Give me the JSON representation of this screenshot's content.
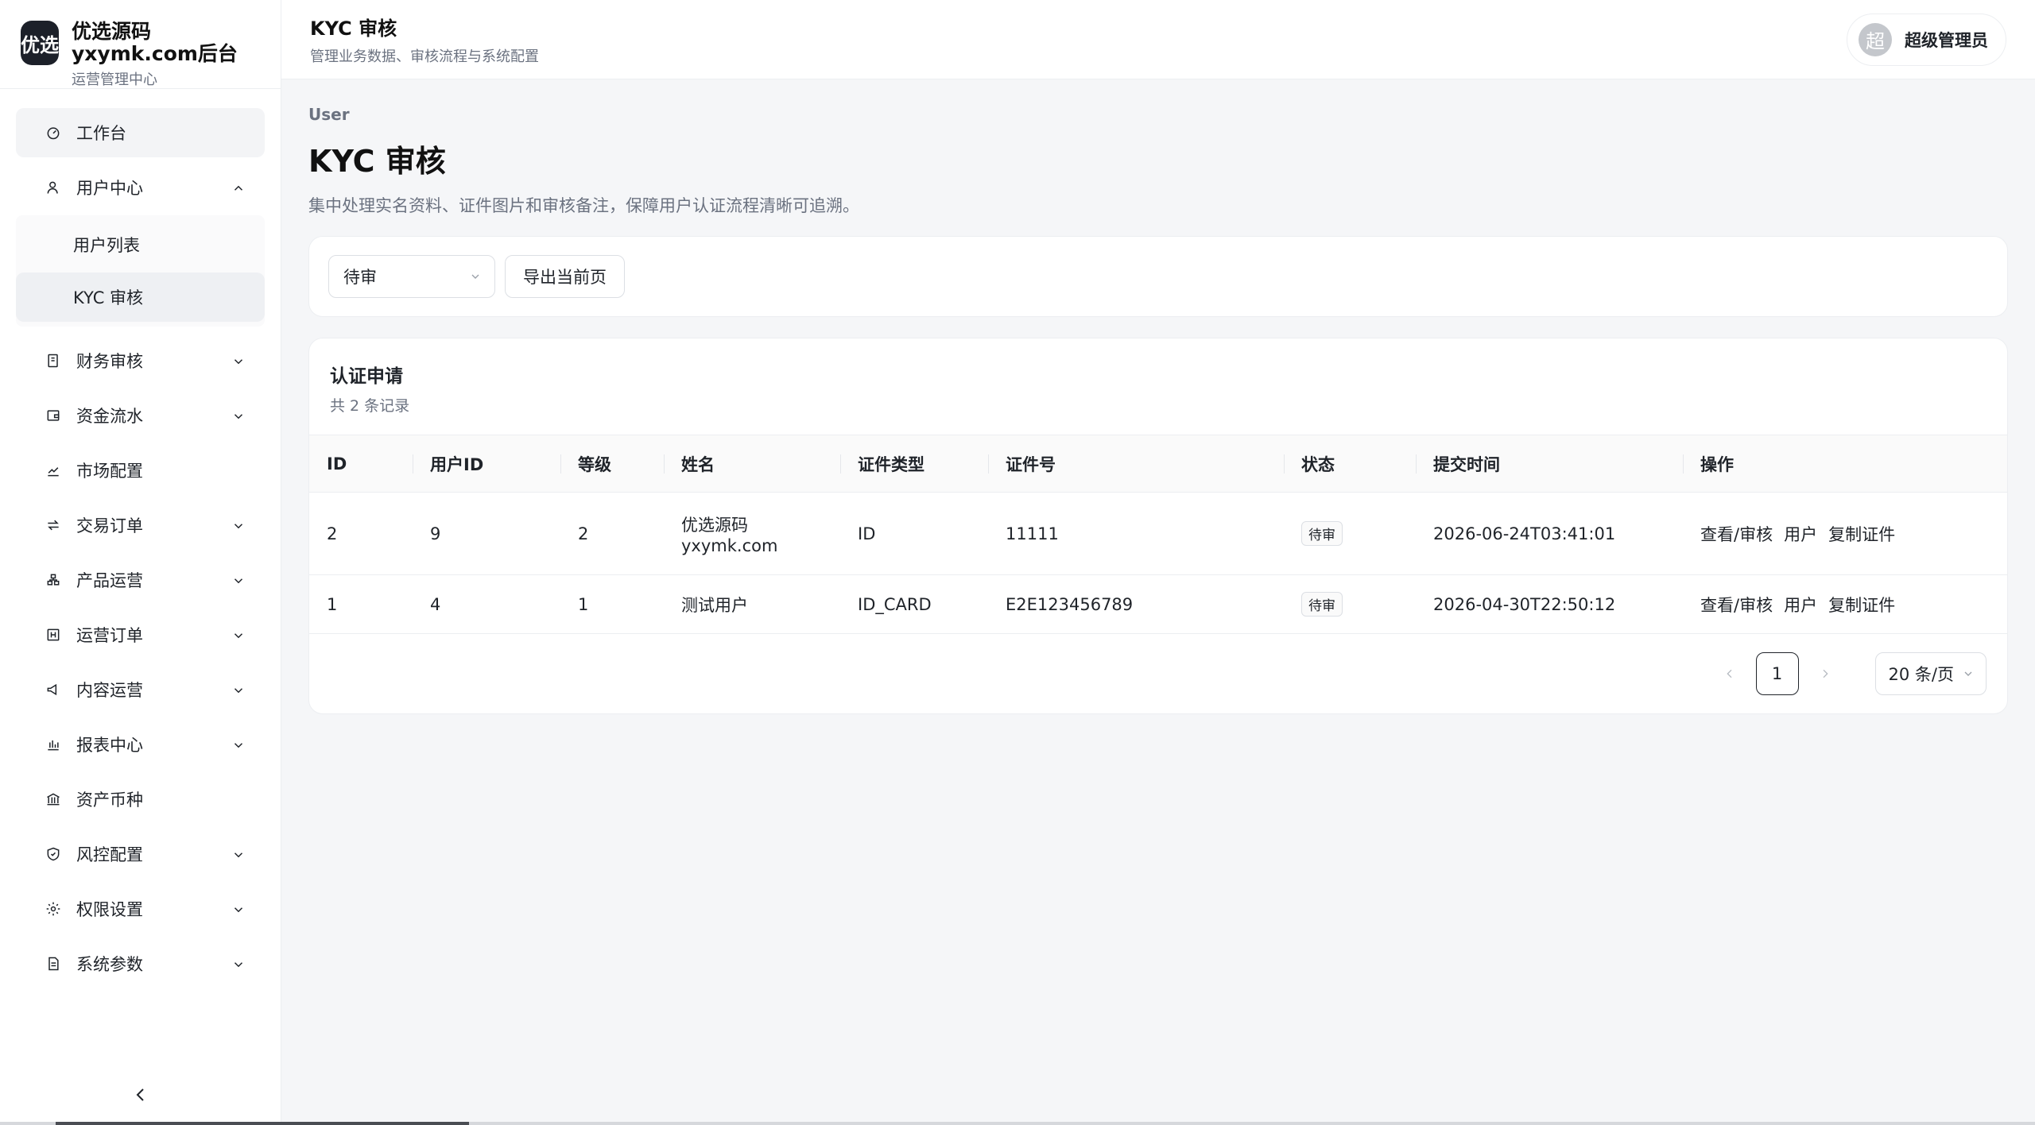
{
  "brand": {
    "logo": "优选",
    "title": "优选源码yxymk.com后台",
    "subtitle": "运营管理中心"
  },
  "nav": {
    "items": [
      {
        "label": "工作台",
        "icon": "dashboard-icon"
      },
      {
        "label": "用户中心",
        "icon": "user-icon",
        "expanded": true
      },
      {
        "label": "财务审核",
        "icon": "finance-icon"
      },
      {
        "label": "资金流水",
        "icon": "wallet-icon"
      },
      {
        "label": "市场配置",
        "icon": "trend-icon"
      },
      {
        "label": "交易订单",
        "icon": "exchange-icon"
      },
      {
        "label": "产品运营",
        "icon": "product-icon"
      },
      {
        "label": "运营订单",
        "icon": "order-icon"
      },
      {
        "label": "内容运营",
        "icon": "megaphone-icon"
      },
      {
        "label": "报表中心",
        "icon": "bar-chart-icon"
      },
      {
        "label": "资产币种",
        "icon": "bank-icon"
      },
      {
        "label": "风控配置",
        "icon": "shield-icon"
      },
      {
        "label": "权限设置",
        "icon": "gear-icon"
      },
      {
        "label": "系统参数",
        "icon": "document-icon"
      }
    ],
    "sub_items": [
      {
        "label": "用户列表"
      },
      {
        "label": "KYC 审核",
        "active": true
      }
    ]
  },
  "topbar": {
    "title": "KYC 审核",
    "subtitle": "管理业务数据、审核流程与系统配置",
    "avatar_char": "超",
    "user_name": "超级管理员"
  },
  "page": {
    "breadcrumb": "User",
    "title": "KYC 审核",
    "description": "集中处理实名资料、证件图片和审核备注，保障用户认证流程清晰可追溯。"
  },
  "filter": {
    "status_value": "待审",
    "export_label": "导出当前页"
  },
  "table": {
    "title": "认证申请",
    "count_text": "共 2 条记录",
    "columns": [
      "ID",
      "用户ID",
      "等级",
      "姓名",
      "证件类型",
      "证件号",
      "状态",
      "提交时间",
      "操作"
    ],
    "rows": [
      {
        "id": "2",
        "user_id": "9",
        "level": "2",
        "name_line1": "优选源码",
        "name_line2": "yxymk.com",
        "doc_type": "ID",
        "doc_no": "11111",
        "status": "待审",
        "submitted": "2026-06-24T03:41:01",
        "ops": [
          "查看/审核",
          "用户",
          "复制证件"
        ]
      },
      {
        "id": "1",
        "user_id": "4",
        "level": "1",
        "name_line1": "测试用户",
        "name_line2": "",
        "doc_type": "ID_CARD",
        "doc_no": "E2E123456789",
        "status": "待审",
        "submitted": "2026-04-30T22:50:12",
        "ops": [
          "查看/审核",
          "用户",
          "复制证件"
        ]
      }
    ]
  },
  "pagination": {
    "current_page": "1",
    "page_size": "20 条/页"
  }
}
